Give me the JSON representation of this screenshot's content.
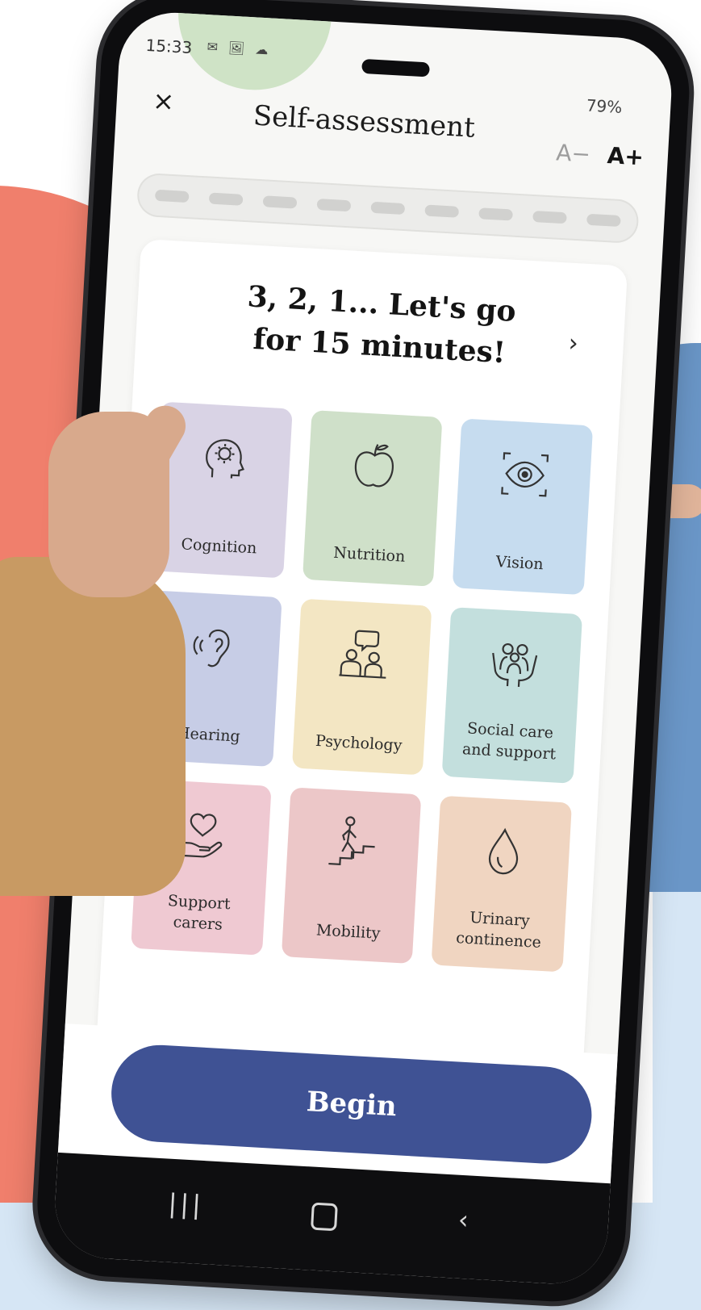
{
  "status_bar": {
    "time": "15:33",
    "notifications": "✉ 🖼 ☁",
    "right": "79%"
  },
  "header": {
    "close_label": "×",
    "title": "Self-assessment",
    "font_decrease": "A−",
    "font_increase": "A+"
  },
  "progress": {
    "segments": 9,
    "completed": 0
  },
  "intro": {
    "line1": "3, 2, 1... Let's go",
    "line2": "for 15 minutes!",
    "next_icon": "›"
  },
  "domains": [
    {
      "label_1": "Cognition",
      "label_2": "",
      "icon": "head-gear-icon",
      "color": "#d9d3e5"
    },
    {
      "label_1": "Nutrition",
      "label_2": "",
      "icon": "apple-icon",
      "color": "#cfe0c9"
    },
    {
      "label_1": "Vision",
      "label_2": "",
      "icon": "eye-icon",
      "color": "#c6dcef"
    },
    {
      "label_1": "Hearing",
      "label_2": "",
      "icon": "ear-icon",
      "color": "#c7cde6"
    },
    {
      "label_1": "Psychology",
      "label_2": "",
      "icon": "people-talk-icon",
      "color": "#f3e6c3"
    },
    {
      "label_1": "Social care",
      "label_2": "and support",
      "icon": "group-hands-icon",
      "color": "#c3dfdd"
    },
    {
      "label_1": "Support",
      "label_2": "carers",
      "icon": "heart-hand-icon",
      "color": "#efc9d2"
    },
    {
      "label_1": "Mobility",
      "label_2": "",
      "icon": "stairs-person-icon",
      "color": "#ecc7c8"
    },
    {
      "label_1": "Urinary",
      "label_2": "continence",
      "icon": "drop-icon",
      "color": "#f0d5c1"
    }
  ],
  "begin_label": "Begin",
  "navbar": {
    "recents": "|||",
    "back": "‹"
  }
}
